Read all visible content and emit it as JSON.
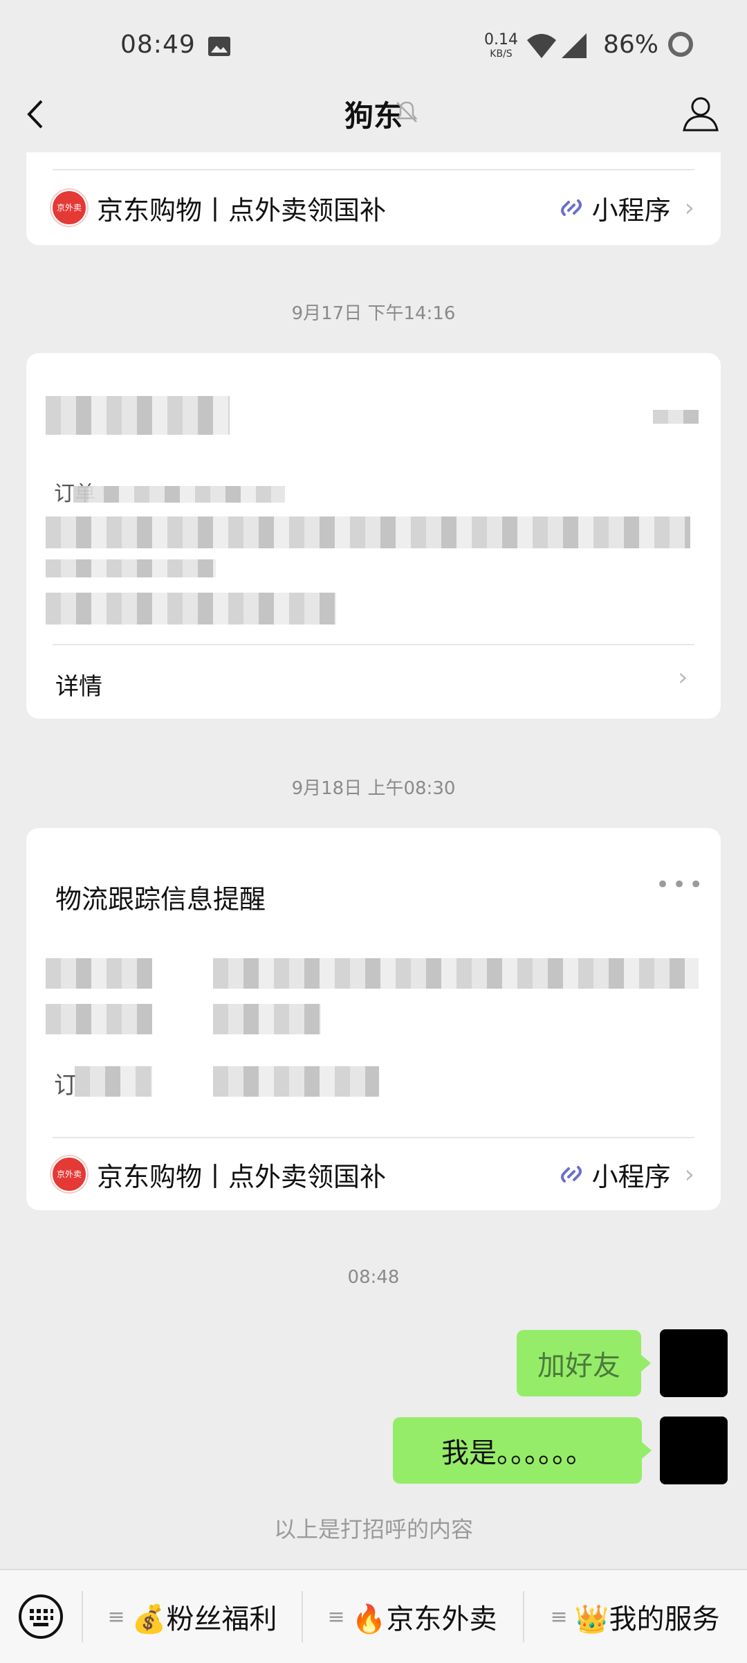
{
  "status_bar": {
    "time": "08:49",
    "net_speed_value": "0.14",
    "net_speed_unit": "KB/S",
    "battery": "86%"
  },
  "nav": {
    "title": "狗东"
  },
  "mini_program": {
    "name": "京东购物丨点外卖领国补",
    "tag": "小程序"
  },
  "messages": {
    "ts1": "9月17日 下午14:16",
    "order_card": {
      "partial_label": "订单",
      "details_label": "详情"
    },
    "ts2": "9月18日 上午08:30",
    "logistics_card": {
      "title": "物流跟踪信息提醒",
      "partial_label": "订"
    },
    "ts3": "08:48",
    "chat": [
      {
        "text": "加好友"
      },
      {
        "text": "我是。。。。。。"
      }
    ],
    "hint": "以上是打招呼的内容"
  },
  "bottom_menu": [
    {
      "label": "💰粉丝福利"
    },
    {
      "label": "🔥京东外卖"
    },
    {
      "label": "👑我的服务"
    }
  ]
}
